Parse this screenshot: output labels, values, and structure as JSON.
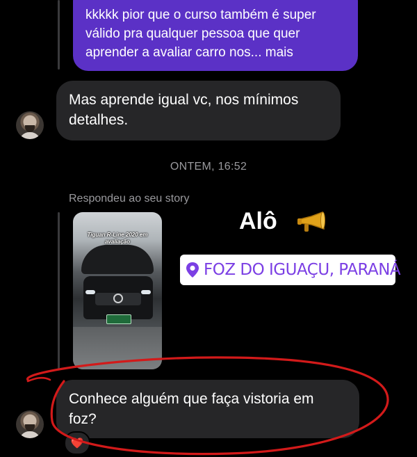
{
  "thread": {
    "sent_message": {
      "text_line1": "kkkkk pior que o curso também é super",
      "text_line2": "válido pra qualquer pessoa que quer",
      "text_line3": "aprender a avaliar carro nos... mais"
    },
    "received_message_1": {
      "line1": "Mas aprende igual vc, nos mínimos",
      "line2": "detalhes."
    },
    "timestamp": "ONTEM, 16:52",
    "story_reply": {
      "note": "Respondeu ao seu story",
      "thumbnail_caption_line1": "Tiguan R-Line 2020 em",
      "thumbnail_caption_line2": "avaliação",
      "story_title": "Alô",
      "location": "FOZ DO IGUAÇU, PARANÁ"
    },
    "received_message_2": {
      "line1": "Conhece alguém que faça vistoria em",
      "line2": "foz?",
      "reaction": "❤️"
    }
  },
  "colors": {
    "sent_bubble": "#5b31c6",
    "received_bubble": "#262628",
    "location_text": "#7b3fe4",
    "annotation_circle": "#d21a1a"
  },
  "icons": [
    "avatar",
    "location-pin-icon",
    "megaphone-icon",
    "heart-reaction-icon"
  ]
}
